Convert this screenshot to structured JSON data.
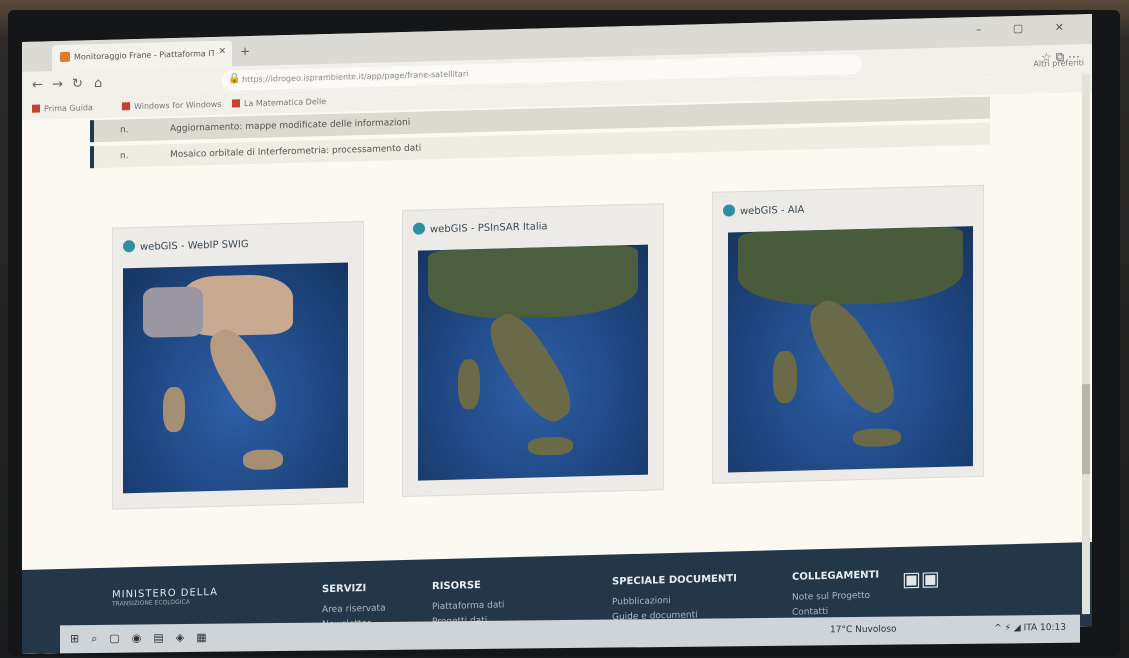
{
  "browser": {
    "tab_title": "Monitoraggio Frane - Piattaforma IT",
    "tab_close": "✕",
    "new_tab": "+",
    "url": "https://idrogeo.isprambiente.it/app/page/frane-satellitari",
    "window_controls": "–  ▢  ✕",
    "bookmarks": [
      "Prima Guida",
      "Windows for Windows",
      "La Matematica Delle"
    ],
    "other_favorites": "Altri preferiti"
  },
  "notices": [
    {
      "num": "n.",
      "text": "Aggiornamento: mappe modificate delle informazioni"
    },
    {
      "num": "n.",
      "text": "Mosaico orbitale di Interferometria: processamento dati"
    }
  ],
  "cards": [
    {
      "title": "webGIS - WebIP SWIG"
    },
    {
      "title": "webGIS - PSInSAR Italia"
    },
    {
      "title": "webGIS - AIA"
    }
  ],
  "footer": {
    "logo": "MINISTERO DELLA",
    "logo_sub": "TRANSIZIONE ECOLOGICA",
    "columns": [
      {
        "heading": "SERVIZI",
        "links": [
          "Area riservata",
          "Newsletter"
        ]
      },
      {
        "heading": "RISORSE",
        "links": [
          "Piattaforma dati",
          "Progetti dati"
        ]
      },
      {
        "heading": "SPECIALE DOCUMENTI",
        "links": [
          "Pubblicazioni",
          "Guide e documenti"
        ]
      },
      {
        "heading": "COLLEGAMENTI",
        "links": [
          "Note sul Progetto",
          "Contatti"
        ]
      }
    ]
  },
  "taskbar": {
    "weather": "17°C Nuvoloso",
    "tray": "^  ⚡  ◢  ITA  10:13"
  }
}
